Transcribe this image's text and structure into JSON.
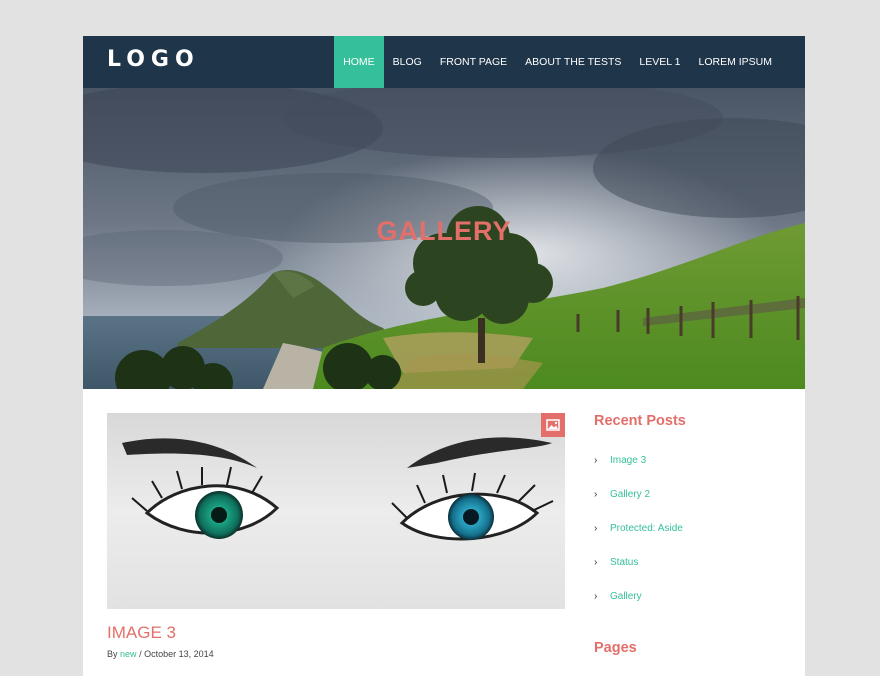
{
  "site": {
    "logo": "LOGO"
  },
  "nav": {
    "items": [
      {
        "label": "HOME",
        "active": true
      },
      {
        "label": "BLOG",
        "active": false
      },
      {
        "label": "FRONT PAGE",
        "active": false
      },
      {
        "label": "ABOUT THE TESTS",
        "active": false
      },
      {
        "label": "LEVEL 1",
        "active": false
      },
      {
        "label": "LOREM IPSUM",
        "active": false
      }
    ]
  },
  "hero": {
    "title": "GALLERY"
  },
  "post": {
    "format_icon": "image-icon",
    "title": "IMAGE 3",
    "by": "By",
    "author": "new",
    "separator": "/",
    "date": "October 13, 2014"
  },
  "sidebar": {
    "recent_title": "Recent Posts",
    "recent_items": [
      "Image 3",
      "Gallery 2",
      "Protected: Aside",
      "Status",
      "Gallery"
    ],
    "pages_title": "Pages"
  },
  "colors": {
    "header_bg": "#1f3549",
    "accent_green": "#35bf9b",
    "accent_coral": "#e36f6a",
    "page_bg": "#e2e2e2"
  }
}
